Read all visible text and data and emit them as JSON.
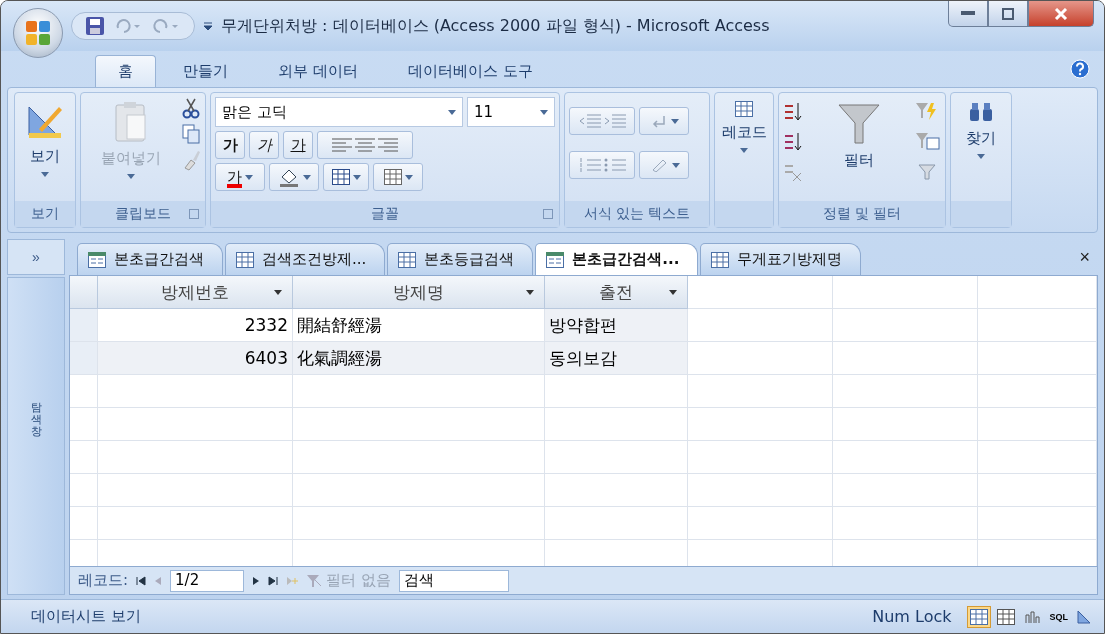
{
  "window": {
    "title": "무게단위처방 : 데이터베이스 (Access 2000 파일 형식) - Microsoft Access"
  },
  "ribbon_tabs": [
    {
      "label": "홈",
      "selected": true
    },
    {
      "label": "만들기",
      "selected": false
    },
    {
      "label": "외부 데이터",
      "selected": false
    },
    {
      "label": "데이터베이스 도구",
      "selected": false
    }
  ],
  "ribbon": {
    "view": {
      "button": "보기",
      "group": "보기"
    },
    "clipboard": {
      "paste": "붙여넣기",
      "group": "클립보드"
    },
    "font": {
      "name": "맑은 고딕",
      "size": "11",
      "bold": "가",
      "italic": "가",
      "underline": "가",
      "font_color": "가",
      "group": "글꼴"
    },
    "rich_text": {
      "group": "서식 있는 텍스트"
    },
    "records": {
      "button": "레코드"
    },
    "sort_filter": {
      "filter": "필터",
      "group": "정렬 및 필터"
    },
    "find": {
      "button": "찾기"
    }
  },
  "nav_pane": {
    "toggle": "»",
    "label": "탐색 창"
  },
  "doc_tabs": [
    {
      "label": "본초급간검색",
      "kind": "form",
      "selected": false
    },
    {
      "label": "검색조건방제...",
      "kind": "table",
      "selected": false
    },
    {
      "label": "본초등급검색",
      "kind": "table",
      "selected": false
    },
    {
      "label": "본초급간검색...",
      "kind": "form",
      "selected": true
    },
    {
      "label": "무게표기방제명",
      "kind": "table",
      "selected": false
    }
  ],
  "close": "×",
  "table": {
    "columns": [
      "방제번호",
      "방제명",
      "출전"
    ],
    "rows": [
      [
        "2332",
        "開結舒經湯",
        "방약합편"
      ],
      [
        "6403",
        "化氣調經湯",
        "동의보감"
      ]
    ]
  },
  "record_nav": {
    "label": "레코드:",
    "position": "1/2",
    "filter": "필터 없음",
    "search": "검색"
  },
  "status_bar": {
    "text": "데이터시트 보기",
    "num_lock": "Num Lock",
    "sql": "SQL"
  }
}
